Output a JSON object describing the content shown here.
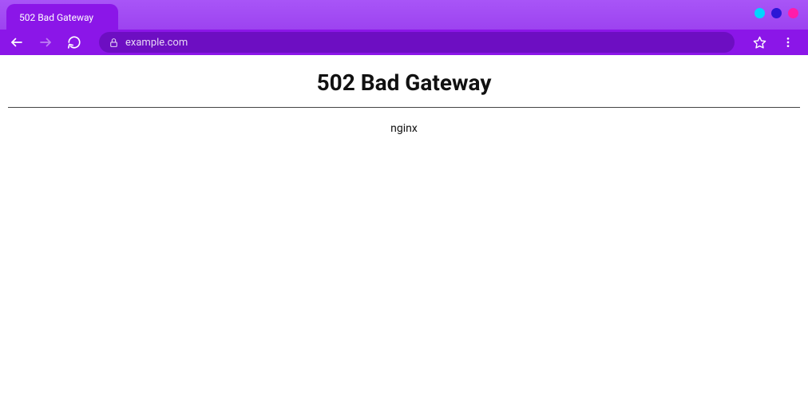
{
  "tab": {
    "title": "502 Bad Gateway"
  },
  "address": {
    "url": "example.com"
  },
  "page": {
    "heading": "502 Bad Gateway",
    "server": "nginx"
  }
}
